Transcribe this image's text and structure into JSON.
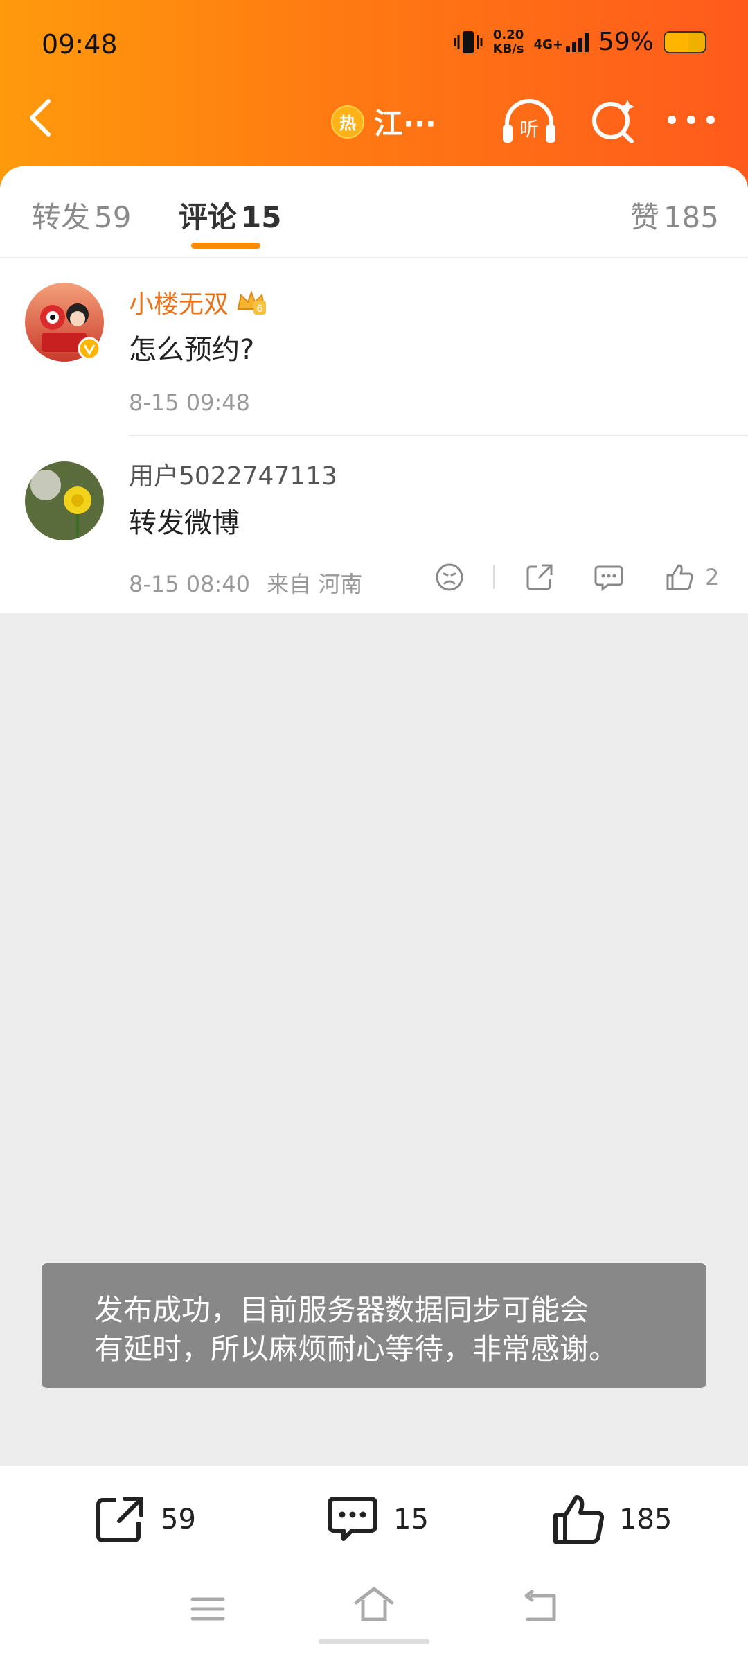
{
  "status_bar": {
    "time": "09:48",
    "speed_value": "0.20",
    "speed_unit": "KB/s",
    "network": "4G+",
    "battery": "59%",
    "battery_level": 0.59
  },
  "nav": {
    "hot_badge": "热",
    "topic_title": "江···",
    "listen_label": "听"
  },
  "tabs": [
    {
      "label": "转发",
      "count": "59"
    },
    {
      "label": "评论",
      "count": "15"
    },
    {
      "label": "赞",
      "count": "185"
    }
  ],
  "comments": [
    {
      "name": "小楼无双",
      "text": "怎么预约?",
      "time": "8-15 09:48",
      "location": "",
      "likes": "",
      "level_badge": "6"
    },
    {
      "name": "用户5022747113",
      "text": "转发微博",
      "time": "8-15 08:40",
      "location": "来自 河南",
      "likes": "2"
    }
  ],
  "toast": {
    "line1": "发布成功，目前服务器数据同步可能会",
    "line2": "有延时，所以麻烦耐心等待，非常感谢。"
  },
  "bottom_bar": {
    "repost_count": "59",
    "comment_count": "15",
    "like_count": "185"
  },
  "colors": {
    "header_start": "#ff9a0c",
    "header_end": "#ff5a1c",
    "accent": "#ff8a00",
    "vip_name": "#e8711a",
    "toast_bg": "#888888"
  }
}
